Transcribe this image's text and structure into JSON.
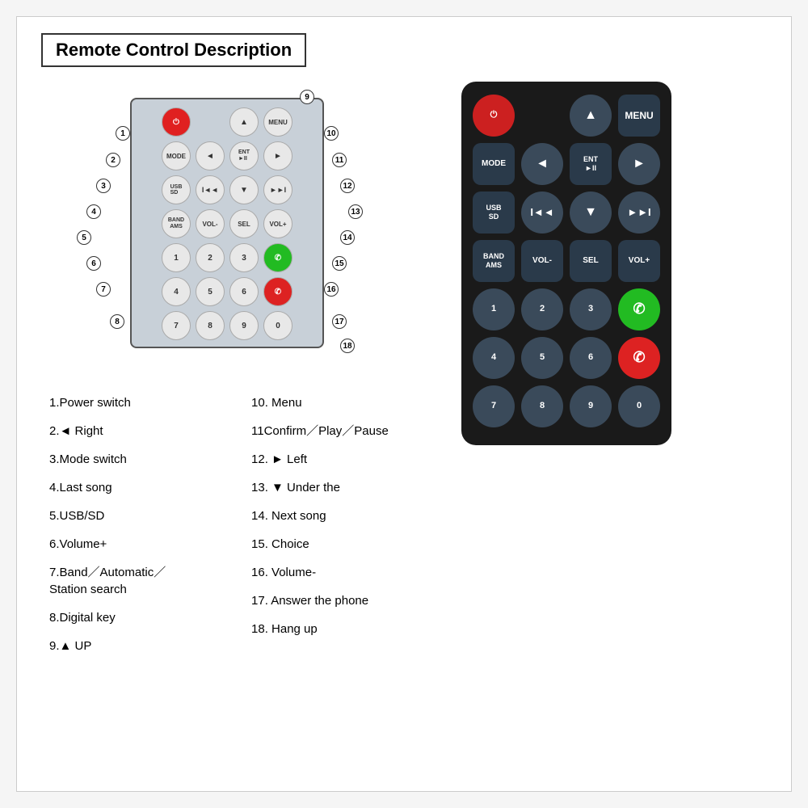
{
  "page": {
    "title": "Remote Control Description"
  },
  "diagram": {
    "callouts": [
      {
        "n": "1",
        "top": "60",
        "left": "60"
      },
      {
        "n": "2",
        "top": "95",
        "left": "50"
      },
      {
        "n": "3",
        "top": "125",
        "left": "40"
      },
      {
        "n": "4",
        "top": "158",
        "left": "30"
      },
      {
        "n": "5",
        "top": "188",
        "left": "20"
      },
      {
        "n": "6",
        "top": "218",
        "left": "30"
      },
      {
        "n": "7",
        "top": "248",
        "left": "40"
      },
      {
        "n": "8",
        "top": "290",
        "left": "60"
      },
      {
        "n": "9",
        "top": "15",
        "left": "290"
      },
      {
        "n": "10",
        "top": "60",
        "left": "320"
      },
      {
        "n": "11",
        "top": "95",
        "left": "330"
      },
      {
        "n": "12",
        "top": "125",
        "left": "340"
      },
      {
        "n": "13",
        "top": "158",
        "left": "350"
      },
      {
        "n": "14",
        "top": "190",
        "left": "340"
      },
      {
        "n": "15",
        "top": "220",
        "left": "330"
      },
      {
        "n": "16",
        "top": "250",
        "left": "320"
      },
      {
        "n": "17",
        "top": "295",
        "left": "330"
      },
      {
        "n": "18",
        "top": "330",
        "left": "340"
      }
    ]
  },
  "descriptions": {
    "left": [
      {
        "num": "1",
        "text": "Power switch"
      },
      {
        "num": "2",
        "text": "◄ Right"
      },
      {
        "num": "3",
        "text": "Mode switch"
      },
      {
        "num": "4",
        "text": "Last song"
      },
      {
        "num": "5",
        "text": "USB/SD"
      },
      {
        "num": "6",
        "text": "Volume+"
      },
      {
        "num": "7",
        "text": "Band／Automatic／\nStation search"
      },
      {
        "num": "8",
        "text": "Digital key"
      },
      {
        "num": "9",
        "text": "▲ UP"
      }
    ],
    "right": [
      {
        "num": "10",
        "text": "Menu"
      },
      {
        "num": "11",
        "text": "Confirm／Play／Pause"
      },
      {
        "num": "12",
        "text": "► Left"
      },
      {
        "num": "13",
        "text": "▼ Under the"
      },
      {
        "num": "14",
        "text": "Next song"
      },
      {
        "num": "15",
        "text": "Choice"
      },
      {
        "num": "16",
        "text": "Volume-"
      },
      {
        "num": "17",
        "text": "Answer the phone"
      },
      {
        "num": "18",
        "text": "Hang up"
      }
    ]
  },
  "remote": {
    "rows": [
      {
        "buttons": [
          {
            "label": "⏻",
            "type": "red-power round",
            "size": "big"
          },
          {
            "label": "",
            "type": "spacer"
          },
          {
            "label": "▲",
            "type": "round arrow"
          },
          {
            "label": "MENU",
            "type": "dark-sq"
          }
        ]
      },
      {
        "buttons": [
          {
            "label": "MODE",
            "type": "dark-sq mode-btn"
          },
          {
            "label": "◄",
            "type": "round arrow"
          },
          {
            "label": "ENT\n►II",
            "type": "dark-sq ent-btn"
          },
          {
            "label": "►",
            "type": "round arrow"
          }
        ]
      },
      {
        "buttons": [
          {
            "label": "USB\nSD",
            "type": "dark-sq usb-btn"
          },
          {
            "label": "I◄◄",
            "type": "round"
          },
          {
            "label": "▼",
            "type": "round arrow"
          },
          {
            "label": "►►I",
            "type": "round"
          }
        ]
      },
      {
        "buttons": [
          {
            "label": "BAND\nAMS",
            "type": "dark-sq band-rbtn"
          },
          {
            "label": "VOL-",
            "type": "dark-sq vol-btn"
          },
          {
            "label": "SEL",
            "type": "dark-sq vol-btn"
          },
          {
            "label": "VOL+",
            "type": "dark-sq vol-btn"
          }
        ]
      },
      {
        "buttons": [
          {
            "label": "1",
            "type": "round"
          },
          {
            "label": "2",
            "type": "round"
          },
          {
            "label": "3",
            "type": "round"
          },
          {
            "label": "📞",
            "type": "green-call round"
          }
        ]
      },
      {
        "buttons": [
          {
            "label": "4",
            "type": "round"
          },
          {
            "label": "5",
            "type": "round"
          },
          {
            "label": "6",
            "type": "round"
          },
          {
            "label": "📵",
            "type": "red-hang round"
          }
        ]
      },
      {
        "buttons": [
          {
            "label": "7",
            "type": "round"
          },
          {
            "label": "8",
            "type": "round"
          },
          {
            "label": "9",
            "type": "round"
          },
          {
            "label": "0",
            "type": "round"
          }
        ]
      }
    ]
  }
}
